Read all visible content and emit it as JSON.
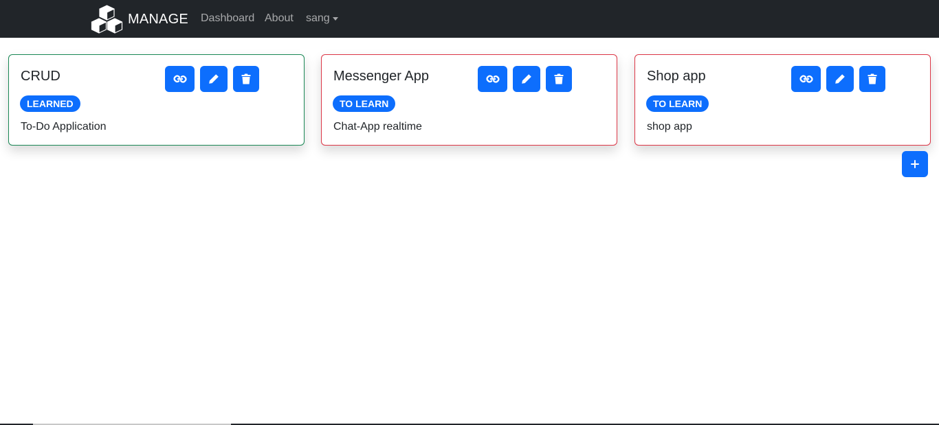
{
  "navbar": {
    "brand": "MANAGE",
    "logo_icon": "cubes-icon",
    "links": [
      "Dashboard",
      "About"
    ],
    "user": "sang"
  },
  "cards": [
    {
      "title": "CRUD",
      "status": "LEARNED",
      "status_color": "#198754",
      "description": "To-Do Application"
    },
    {
      "title": "Messenger App",
      "status": "TO LEARN",
      "status_color": "#dc3545",
      "description": "Chat-App realtime"
    },
    {
      "title": "Shop app",
      "status": "TO LEARN",
      "status_color": "#dc3545",
      "description": "shop app"
    }
  ],
  "card_actions": [
    "link-icon",
    "pencil-icon",
    "trash-icon"
  ],
  "add_button": {
    "icon": "plus-icon"
  },
  "colors": {
    "primary": "#0d6efd",
    "navbar": "#212529",
    "learned": "#198754",
    "to_learn": "#dc3545"
  }
}
